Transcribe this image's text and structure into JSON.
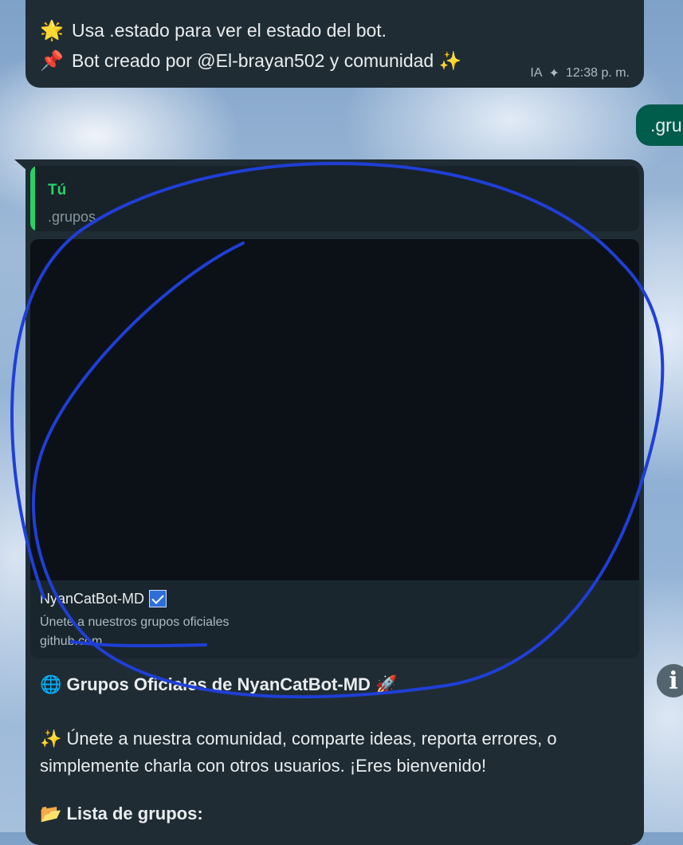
{
  "top_message": {
    "line1_emoji": "🌟",
    "line1": "Usa .estado para ver el estado del bot.",
    "line2_emoji": "📌",
    "line2": "Bot creado por @El-brayan502 y comunidad ✨",
    "ai_label": "IA",
    "time": "12:38 p. m."
  },
  "sent_message": {
    "text": ".gru"
  },
  "reply_message": {
    "quote": {
      "author": "Tú",
      "text": ".grupos"
    },
    "link_preview": {
      "title": "NyanCatBot-MD",
      "description": "Únete a nuestros grupos oficiales",
      "domain": "github.com"
    },
    "heading_emoji": "🌐",
    "heading": "Grupos Oficiales de NyanCatBot-MD 🚀",
    "intro_emoji": "✨",
    "intro_line1": "Únete a nuestra comunidad, comparte ideas, reporta errores, o",
    "intro_line2": "simplemente charla con otros usuarios. ¡Eres bienvenido!",
    "list_emoji": "📂",
    "list_heading": "Lista de grupos:"
  },
  "info_button": {
    "label": "i"
  },
  "colors": {
    "bubble": "#1f2c34",
    "sent_bubble": "#005c4b",
    "quote_accent": "#25d366",
    "annotation": "#1f3fd6"
  }
}
